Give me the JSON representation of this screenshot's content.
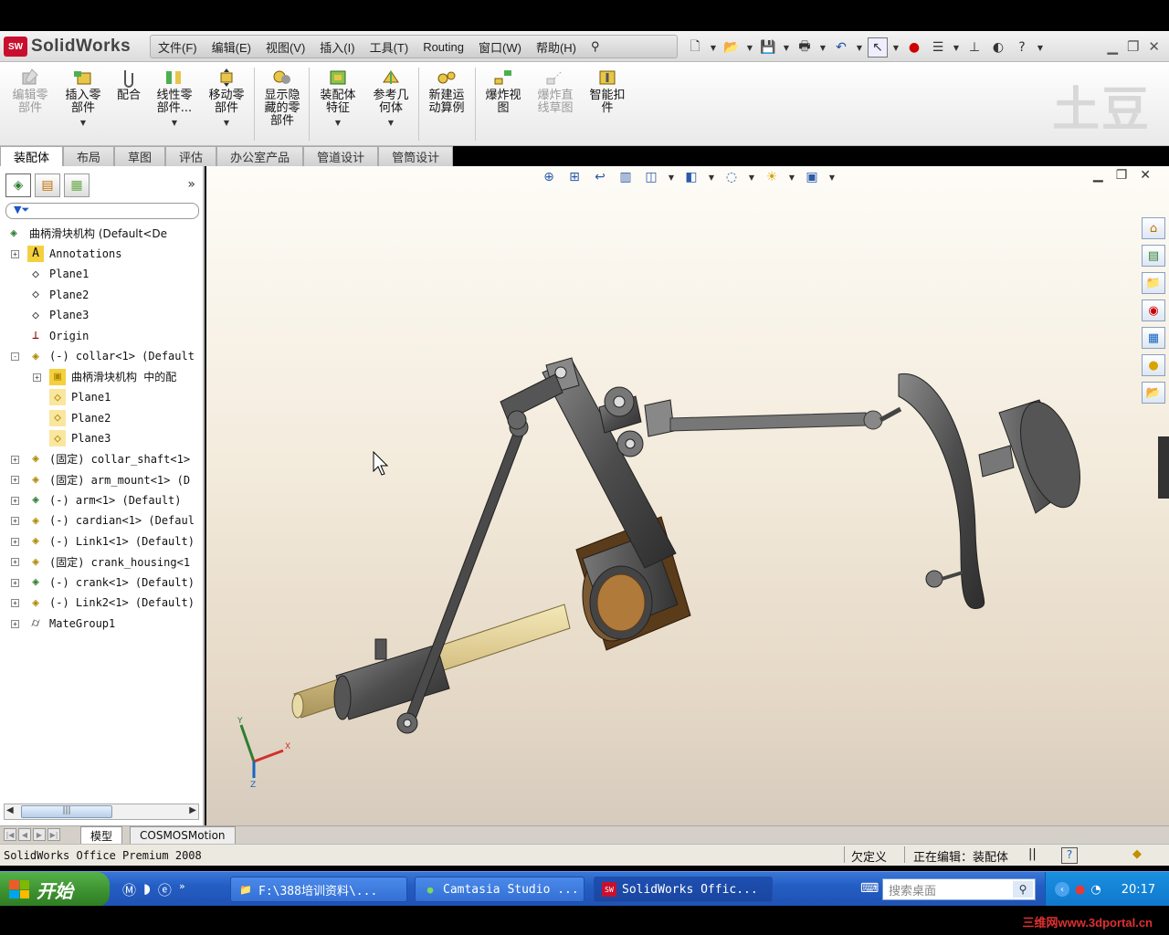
{
  "app": {
    "name": "SolidWorks",
    "logo_badge": "SW"
  },
  "menu": [
    "文件(F)",
    "编辑(E)",
    "视图(V)",
    "插入(I)",
    "工具(T)",
    "Routing",
    "窗口(W)",
    "帮助(H)"
  ],
  "command_manager": {
    "buttons": [
      {
        "label": "编辑零\n部件",
        "enabled": false
      },
      {
        "label": "插入零\n部件",
        "enabled": true
      },
      {
        "label": "配合",
        "enabled": true
      },
      {
        "label": "线性零\n部件...",
        "enabled": true
      },
      {
        "label": "移动零\n部件",
        "enabled": true
      },
      {
        "label": "显示隐\n藏的零\n部件",
        "enabled": true
      },
      {
        "label": "装配体\n特征",
        "enabled": true
      },
      {
        "label": "参考几\n何体",
        "enabled": true
      },
      {
        "label": "新建运\n动算例",
        "enabled": true
      },
      {
        "label": "爆炸视\n图",
        "enabled": true
      },
      {
        "label": "爆炸直\n线草图",
        "enabled": false
      },
      {
        "label": "智能扣\n件",
        "enabled": true
      }
    ],
    "watermark": "土豆"
  },
  "tabs": [
    "装配体",
    "布局",
    "草图",
    "评估",
    "办公室产品",
    "管道设计",
    "管筒设计"
  ],
  "active_tab": "装配体",
  "feature_tree": {
    "root": "曲柄滑块机构  (Default<De",
    "items": [
      {
        "label": "Annotations",
        "level": 1,
        "expander": "+",
        "icon": "annotations-icon"
      },
      {
        "label": "Plane1",
        "level": 1,
        "expander": "",
        "icon": "plane-icon"
      },
      {
        "label": "Plane2",
        "level": 1,
        "expander": "",
        "icon": "plane-icon"
      },
      {
        "label": "Plane3",
        "level": 1,
        "expander": "",
        "icon": "plane-icon"
      },
      {
        "label": "Origin",
        "level": 1,
        "expander": "",
        "icon": "origin-icon"
      },
      {
        "label": "(-) collar<1> (Default",
        "level": 1,
        "expander": "-",
        "icon": "part-icon"
      },
      {
        "label": "曲柄滑块机构 中的配",
        "level": 2,
        "expander": "+",
        "icon": "mates-icon"
      },
      {
        "label": "Plane1",
        "level": 2,
        "expander": "",
        "icon": "plane-yellow-icon"
      },
      {
        "label": "Plane2",
        "level": 2,
        "expander": "",
        "icon": "plane-yellow-icon"
      },
      {
        "label": "Plane3",
        "level": 2,
        "expander": "",
        "icon": "plane-yellow-icon"
      },
      {
        "label": "(固定) collar_shaft<1>",
        "level": 1,
        "expander": "+",
        "icon": "part-icon"
      },
      {
        "label": "(固定) arm_mount<1> (D",
        "level": 1,
        "expander": "+",
        "icon": "part-icon"
      },
      {
        "label": "(-) arm<1> (Default)",
        "level": 1,
        "expander": "+",
        "icon": "subassembly-icon"
      },
      {
        "label": "(-) cardian<1> (Defaul",
        "level": 1,
        "expander": "+",
        "icon": "part-icon"
      },
      {
        "label": "(-) Link1<1> (Default)",
        "level": 1,
        "expander": "+",
        "icon": "part-icon"
      },
      {
        "label": "(固定) crank_housing<1",
        "level": 1,
        "expander": "+",
        "icon": "part-icon"
      },
      {
        "label": "(-) crank<1> (Default)",
        "level": 1,
        "expander": "+",
        "icon": "subassembly-icon"
      },
      {
        "label": "(-) Link2<1> (Default)",
        "level": 1,
        "expander": "+",
        "icon": "part-icon"
      },
      {
        "label": "MateGroup1",
        "level": 1,
        "expander": "+",
        "icon": "mategroup-icon"
      }
    ]
  },
  "bottom_tabs": [
    "模型",
    "COSMOSMotion"
  ],
  "status": {
    "product": "SolidWorks Office Premium 2008",
    "definition": "欠定义",
    "editing": "正在编辑：装配体"
  },
  "taskbar": {
    "start": "开始",
    "tasks": [
      {
        "label": "F:\\388培训资料\\...",
        "icon": "folder-icon"
      },
      {
        "label": "Camtasia Studio ...",
        "icon": "camtasia-icon"
      },
      {
        "label": "SolidWorks Offic...",
        "icon": "solidworks-icon"
      }
    ],
    "search_placeholder": "搜索桌面",
    "clock": "20:17"
  },
  "site_watermark": "三维网www.3dportal.cn",
  "colors": {
    "accent": "#c8102e",
    "taskbar": "#245ec4",
    "start": "#3b8f2e"
  }
}
